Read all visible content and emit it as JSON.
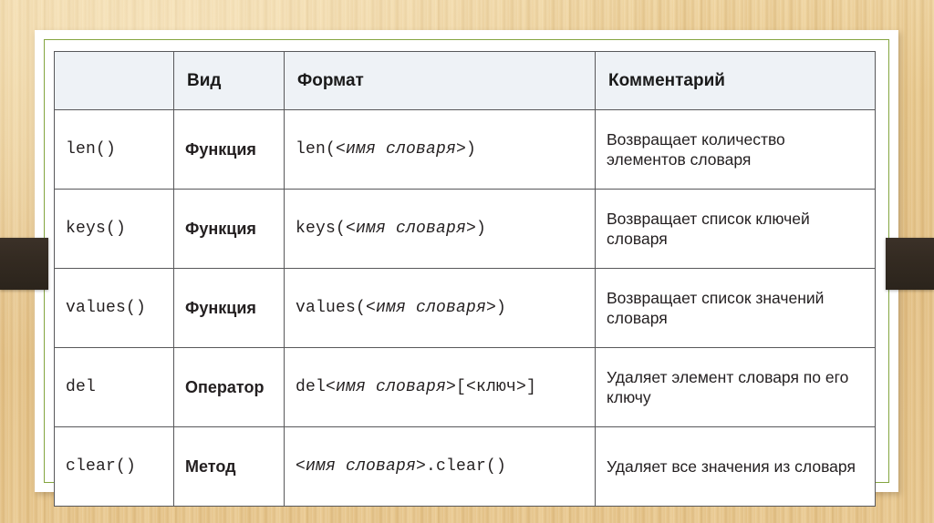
{
  "slide": {
    "background_color": "#e8c98d",
    "card_background": "#ffffff",
    "card_border_color": "#84a540",
    "strap_color": "#332a21"
  },
  "table": {
    "header_background": "#eef2f6",
    "border_color": "#58585a",
    "columns": [
      "",
      "Вид",
      "Формат",
      "Комментарий"
    ],
    "rows": [
      {
        "name": "len()",
        "kind": "Функция",
        "format_prefix": "len(",
        "format_italic": "<имя словаря>",
        "format_suffix": ")",
        "note": "Возвращает количество элементов словаря"
      },
      {
        "name": "keys()",
        "kind": "Функция",
        "format_prefix": "keys(",
        "format_italic": "<имя словаря>",
        "format_suffix": ")",
        "note": "Возвращает список ключей словаря"
      },
      {
        "name": "values()",
        "kind": "Функция",
        "format_prefix": "values(",
        "format_italic": "<имя словаря>",
        "format_suffix": ")",
        "note": "Возвращает список значений словаря"
      },
      {
        "name": "del",
        "kind": "Оператор",
        "format_prefix": "del",
        "format_italic": "<имя словаря>",
        "format_suffix": "[<ключ>]",
        "note": "Удаляет элемент словаря по его ключу"
      },
      {
        "name": "clear()",
        "kind": "Метод",
        "format_prefix": "",
        "format_italic": "<имя словаря>",
        "format_suffix": ".clear()",
        "note": "Удаляет все значения из словаря"
      }
    ]
  }
}
